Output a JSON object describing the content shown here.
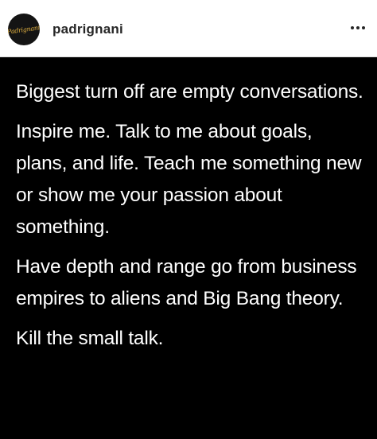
{
  "post": {
    "avatar_text": "Padrignani",
    "username": "padrignani",
    "more_icon": "more-horizontal-icon",
    "paragraphs": [
      "Biggest turn off are empty conversations.",
      "Inspire me. Talk to me about goals, plans, and life. Teach me something new or show me your passion about something.",
      "Have depth and range go from business empires to aliens and Big Bang theory.",
      "Kill the small talk."
    ]
  },
  "colors": {
    "background": "#000000",
    "header_background": "#ffffff",
    "text": "#ffffff",
    "username": "#262626"
  }
}
